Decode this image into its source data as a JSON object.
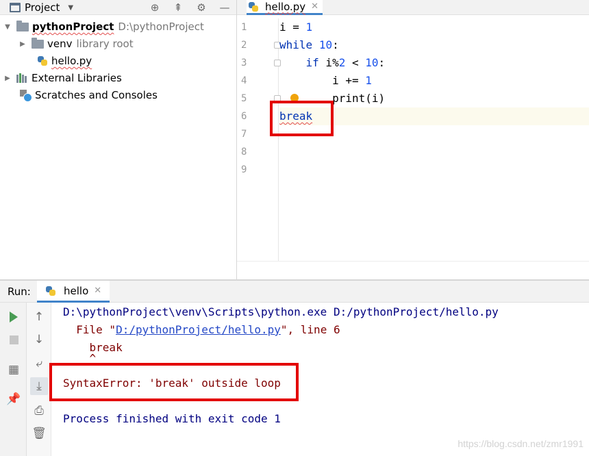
{
  "project_panel": {
    "title": "Project",
    "header_icons": [
      "locate-icon",
      "collapse-icon",
      "gear-icon",
      "minimize-icon"
    ],
    "tree": {
      "root_name": "pythonProject",
      "root_path": "D:\\pythonProject",
      "venv_name": "venv",
      "venv_note": "library root",
      "file_name": "hello.py",
      "external_libraries": "External Libraries",
      "scratches": "Scratches and Consoles"
    }
  },
  "editor": {
    "tab_label": "hello.py",
    "line_numbers": [
      "1",
      "2",
      "3",
      "4",
      "5",
      "6",
      "7",
      "8",
      "9"
    ],
    "current_line": "6"
  },
  "code": {
    "l1": {
      "var": "i",
      "eq": " = ",
      "num": "1"
    },
    "l2": {
      "kw": "while",
      "num": "10",
      "colon": ":"
    },
    "l3": {
      "kw": "if",
      "expr": " i%",
      "num": "2",
      "lt": " < ",
      "num2": "10",
      "colon": ":"
    },
    "l4": {
      "text": "i += ",
      "num": "1"
    },
    "l5": {
      "text": "print(i)"
    },
    "l6": {
      "text": "break"
    }
  },
  "run_panel": {
    "label": "Run:",
    "tab": "hello",
    "console": {
      "cmd": "D:\\pythonProject\\venv\\Scripts\\python.exe D:/pythonProject/hello.py",
      "file_prefix": "  File \"",
      "file_link": "D:/pythonProject/hello.py",
      "file_suffix": "\", line 6",
      "code_line": "    break",
      "caret": "    ^",
      "error": "SyntaxError: 'break' outside loop",
      "exit": "Process finished with exit code 1"
    }
  },
  "watermark": "https://blog.csdn.net/zmr1991",
  "colors": {
    "keyword": "#0033b3",
    "number": "#1750eb",
    "console_cmd": "#000080",
    "console_error": "#7f0000",
    "highlight_box": "#e30000"
  }
}
